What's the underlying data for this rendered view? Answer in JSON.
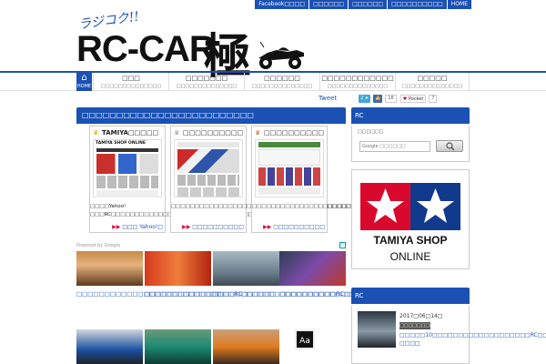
{
  "topbar": {
    "links": [
      "Facebook□□□□",
      "□□□□□□",
      "□□□□□□",
      "□□□□□□□□□□",
      "HOME"
    ]
  },
  "logo": {
    "kana": "ラジコク!!",
    "main": "RC-CAR",
    "kanji": "極"
  },
  "nav": {
    "home": "HOME",
    "items": [
      {
        "title": "□□□",
        "sub": "□□□□□□□□□□□□□□"
      },
      {
        "title": "□□□□□□□",
        "sub": "□□□□□□□□□□□□□□"
      },
      {
        "title": "□□□□□□",
        "sub": "□□□□□□□□□□□□□□"
      },
      {
        "title": "□□□□□□□□□□□□",
        "sub": "□□□□□□□□□□□□□□"
      },
      {
        "title": "□□□□□",
        "sub": "□□□□□□□□□□□□□□"
      }
    ]
  },
  "social": {
    "tweet": "Tweet",
    "share_count": "2",
    "like_count": "16",
    "pocket_label": "Pocket",
    "pocket_count": "7"
  },
  "main": {
    "heading": "□□□□□□□□□□□□□□□□□□□□□□□□□",
    "cards": [
      {
        "title": "TAMIYA□□□□□",
        "shop_label": "TAMIYA SHOP ONLINE",
        "desc": "□□□□Yahoo!□□□RC□□□□□□□□□□□□□□□□□□□□□□□□□□□□□□□",
        "more": "□□□ Yahoo!□"
      },
      {
        "title": "□□□□□□□□□□",
        "desc": "□□□□□□□□□□□□□□□□□□□□□□□□□□□□□□□□□□□□□□",
        "more": "□□□□□□□□□□"
      },
      {
        "title": "□□□□□□□□□□",
        "desc": "□□□□□□□□□□□□□□□□□□□□□□□□□□□□□□□□□□□□□□",
        "more": "□□□□□□□□□□"
      }
    ],
    "ad_label": "Powered by Google",
    "thumbs": [
      {
        "caption": "□□□□□□□□□□□□□□□□□□□□□□□□□□"
      },
      {
        "caption": "□□□□□□□□□□□□□□□□RC□□□□□□"
      },
      {
        "caption": "□□□□□□□□□□□□□□□□□□□□□□RC□□□"
      },
      {
        "caption": "□□□□□□□□□□□□□□□□□□□□□□ESC□□□□□"
      }
    ],
    "aa_icon": "Aa"
  },
  "sidebar": {
    "head1": "RC",
    "search_label": "□□□□□□",
    "search_placeholder": "Google □□□□□□",
    "banner": {
      "line1": "TAMIYA SHOP",
      "line2": "ONLINE"
    },
    "head2": "RC",
    "post": {
      "date": "2017□06□14□",
      "category": "□□□□□□□□□",
      "title": "□□□□□10□□□□□□□□□□□□□□□□□□□RC□□□□□ □□□□"
    }
  },
  "colors": {
    "brand_blue": "#1b51b5",
    "tamiya_red": "#d8092d"
  }
}
